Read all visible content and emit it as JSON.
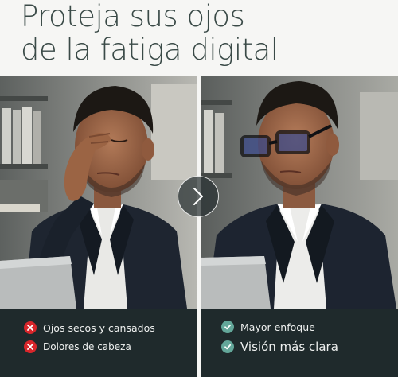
{
  "headline": {
    "line1": "Proteja sus ojos",
    "line2": "de la fatiga digital"
  },
  "left_panel": {
    "items": [
      {
        "icon": "x-icon",
        "text": "Ojos secos y cansados"
      },
      {
        "icon": "x-icon",
        "text": "Dolores de cabeza"
      }
    ]
  },
  "right_panel": {
    "items": [
      {
        "icon": "check-icon",
        "text": "Mayor enfoque"
      },
      {
        "icon": "check-icon",
        "text": "Visión más clara"
      }
    ]
  },
  "colors": {
    "headline": "#3a4a47",
    "info_bg": "#1f2a2c",
    "x_icon": "#d8262b",
    "check_icon": "#63a79a"
  }
}
